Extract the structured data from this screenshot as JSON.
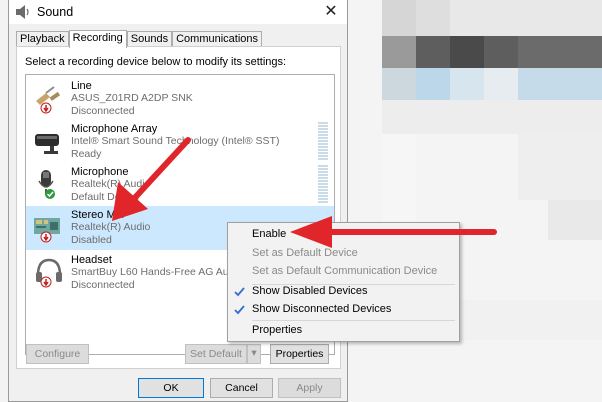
{
  "window": {
    "title": "Sound",
    "close_glyph": "✕"
  },
  "tabs": [
    {
      "label": "Playback"
    },
    {
      "label": "Recording"
    },
    {
      "label": "Sounds"
    },
    {
      "label": "Communications"
    }
  ],
  "instruction": "Select a recording device below to modify its settings:",
  "devices": [
    {
      "name": "Line",
      "description": "ASUS_Z01RD A2DP SNK",
      "status": "Disconnected",
      "icon": "line-in-icon"
    },
    {
      "name": "Microphone Array",
      "description": "Intel® Smart Sound Technology (Intel® SST)",
      "status": "Ready",
      "icon": "microphone-array-icon"
    },
    {
      "name": "Microphone",
      "description": "Realtek(R) Audio",
      "status": "Default Device",
      "icon": "microphone-icon"
    },
    {
      "name": "Stereo Mix",
      "description": "Realtek(R) Audio",
      "status": "Disabled",
      "icon": "stereo-mix-icon"
    },
    {
      "name": "Headset",
      "description": "SmartBuy L60 Hands-Free AG Audio",
      "status": "Disconnected",
      "icon": "headset-icon"
    }
  ],
  "buttons": {
    "configure": "Configure",
    "set_default": "Set Default",
    "properties": "Properties",
    "ok": "OK",
    "cancel": "Cancel",
    "apply": "Apply"
  },
  "context_menu": {
    "enable": "Enable",
    "set_default_device": "Set as Default Device",
    "set_default_comm": "Set as Default Communication Device",
    "show_disabled": "Show Disabled Devices",
    "show_disconnected": "Show Disconnected Devices",
    "properties": "Properties"
  },
  "colors": {
    "selection": "#cce8ff",
    "annotation_arrow": "#e0262b",
    "check": "#2e6fd0"
  }
}
